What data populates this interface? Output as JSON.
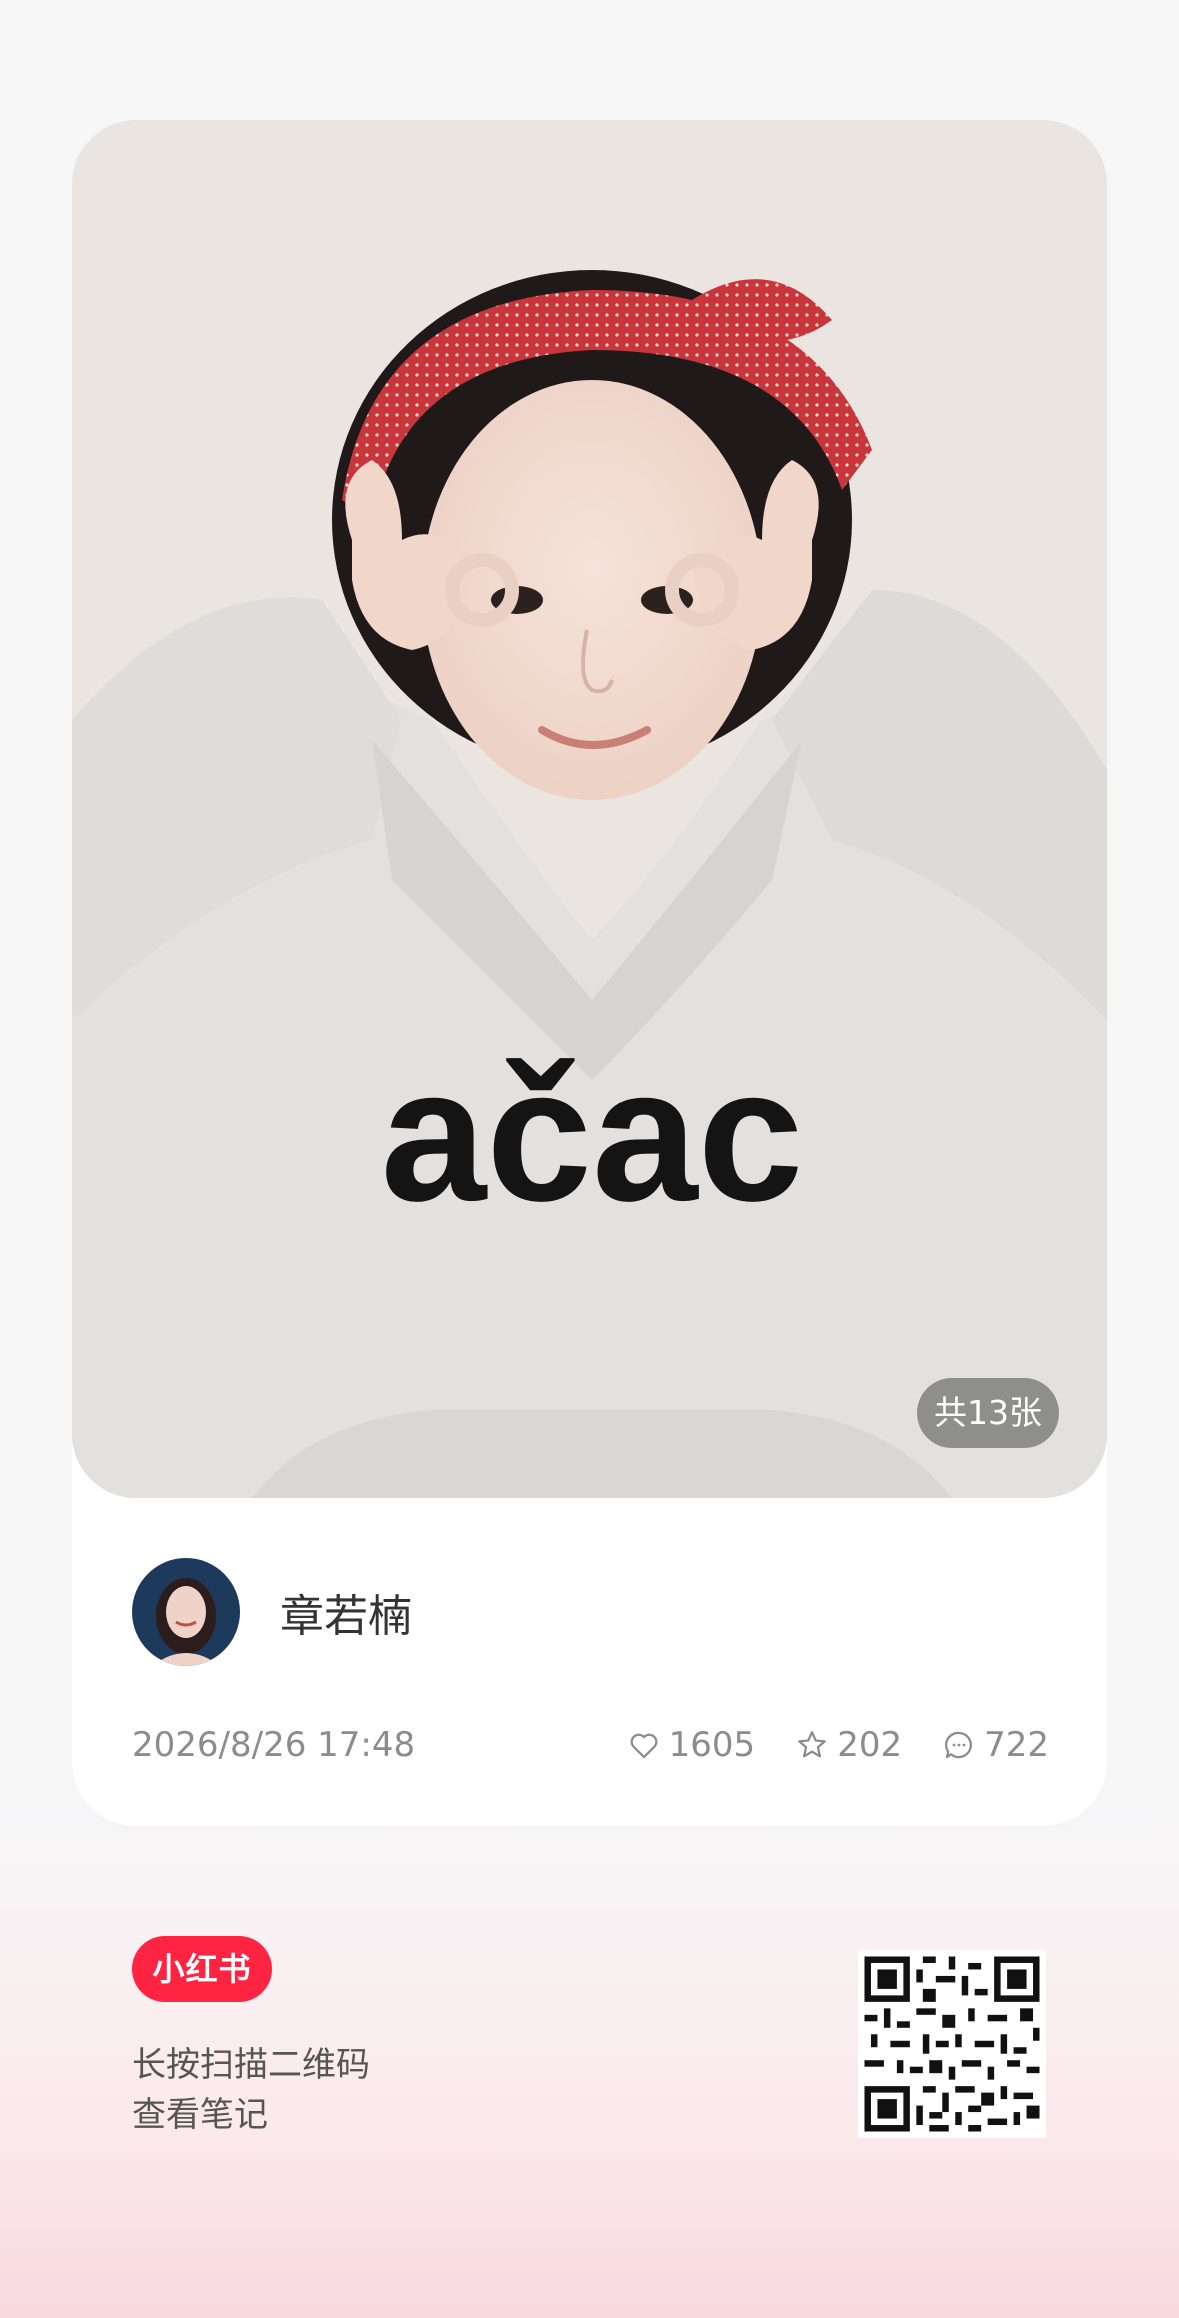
{
  "photo": {
    "count_label": "共13张",
    "shirt_print": "ačac"
  },
  "author": {
    "name": "章若楠"
  },
  "meta": {
    "date": "2026/8/26 17:48",
    "likes": "1605",
    "collects": "202",
    "comments": "722"
  },
  "footer": {
    "logo": "小红书",
    "line1": "长按扫描二维码",
    "line2": "查看笔记"
  },
  "colors": {
    "brand": "#ff2442",
    "headband": "#c8363b",
    "hoodie": "#e3e1df"
  }
}
